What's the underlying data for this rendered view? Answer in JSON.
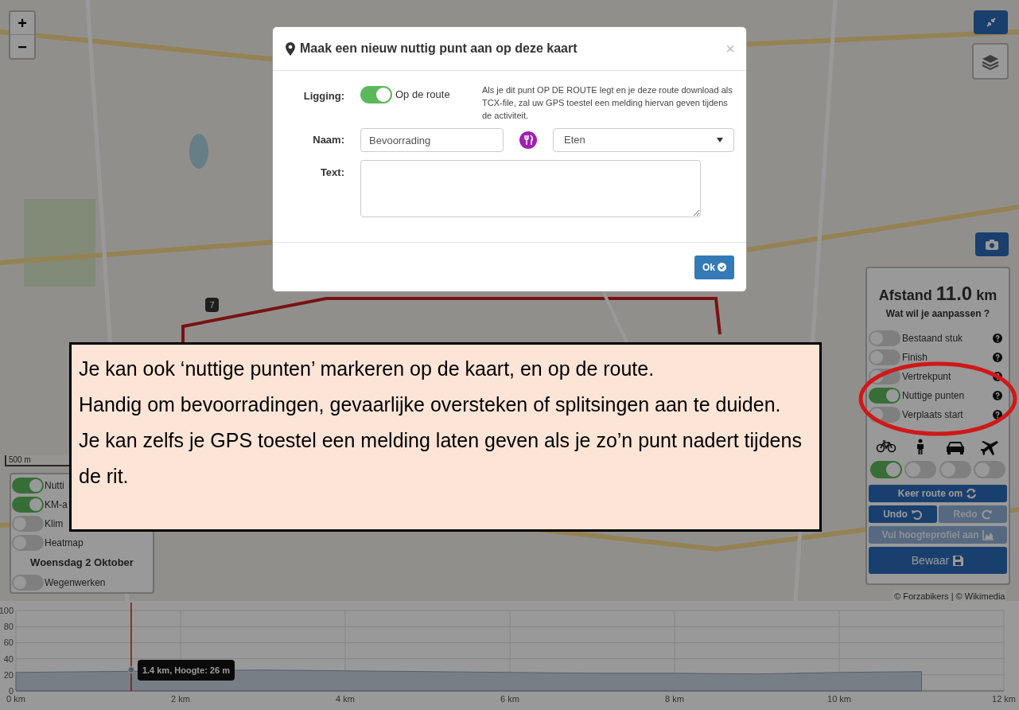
{
  "map": {
    "zoom_controls": [
      "+",
      "−"
    ],
    "scale": "500 m",
    "route_markers": [
      "7"
    ],
    "attribution": "© Forzabikers | © Wikimedia"
  },
  "layers_panel": {
    "layers": [
      {
        "label": "Nutti",
        "on": true
      },
      {
        "label": "KM-a",
        "on": true
      },
      {
        "label": "Klim",
        "on": false
      },
      {
        "label": "Heatmap",
        "on": false
      }
    ],
    "date": "Woensdag 2 Oktober",
    "extra_layers": [
      {
        "label": "Wegenwerken",
        "on": false
      }
    ]
  },
  "route_panel": {
    "distance_label": "Afstand",
    "distance": "11.0",
    "unit": "km",
    "question": "Wat wil je aanpassen ?",
    "options": [
      {
        "label": "Bestaand stuk",
        "on": false
      },
      {
        "label": "Finish",
        "on": false
      },
      {
        "label": "Vertrekpunt",
        "on": false
      },
      {
        "label": "Nuttige punten",
        "on": true
      },
      {
        "label": "Verplaats start",
        "on": false
      }
    ],
    "transport": [
      {
        "kind": "bike",
        "on": true
      },
      {
        "kind": "walk",
        "on": false
      },
      {
        "kind": "car",
        "on": false
      },
      {
        "kind": "plane",
        "on": false
      }
    ],
    "buttons": [
      {
        "label": "Keer route om",
        "kind": "reverse",
        "disabled": false
      },
      {
        "label": "Undo",
        "kind": "undo",
        "disabled": false
      },
      {
        "label": "Redo",
        "kind": "redo",
        "disabled": true
      },
      {
        "label": "Vul hoogteprofiel aan",
        "kind": "profile",
        "disabled": true
      },
      {
        "label": "Bewaar",
        "kind": "save",
        "disabled": false
      }
    ]
  },
  "elevation": {
    "chart_data": {
      "type": "area",
      "x": [
        0,
        1,
        3,
        4,
        5,
        6,
        7,
        8,
        9,
        10,
        11
      ],
      "values": [
        23,
        24,
        26,
        25,
        24,
        23,
        22,
        22,
        21,
        23,
        24
      ],
      "xlim": [
        0,
        12
      ],
      "ylim": [
        0,
        100
      ],
      "grid": true,
      "ref_lines": [
        {
          "axis": "x",
          "value": 1.4,
          "color": "#d02020"
        }
      ],
      "xticks": [
        {
          "value": 0,
          "label": "0 km"
        },
        {
          "value": 2,
          "label": "2 km"
        },
        {
          "value": 4,
          "label": "4 km"
        },
        {
          "value": 6,
          "label": "6 km"
        },
        {
          "value": 8,
          "label": "8 km"
        },
        {
          "value": 10,
          "label": "10 km"
        },
        {
          "value": 12,
          "label": "12 km"
        }
      ],
      "yticks": [
        0,
        20,
        40,
        60,
        80,
        100
      ],
      "annotations": [
        {
          "x": 1.4,
          "y": 26,
          "text": "1.4 km, Hoogte: 26 m"
        }
      ]
    }
  },
  "modal": {
    "title": "Maak een nieuw nuttig punt aan op deze kaart",
    "close": "×",
    "location_label": "Ligging:",
    "on_route": true,
    "on_route_label": "Op de route",
    "help": "Als je dit punt OP DE ROUTE legt en je deze route download als TCX-file, zal uw GPS toestel een melding hiervan geven tijdens de activiteit.",
    "name_label": "Naam:",
    "name_value": "Bevoorrading",
    "category": "Eten",
    "text_label": "Text:",
    "ok_button": "Ok"
  },
  "annotation": {
    "paragraphs": [
      "Je kan ook ‘nuttige punten’ markeren op de kaart, en op de route.",
      "Handig om bevoorradingen, gevaarlijke oversteken of splitsingen aan te duiden.",
      "Je kan zelfs je GPS toestel een melding laten geven als je zo’n punt nadert tijdens de rit."
    ]
  }
}
